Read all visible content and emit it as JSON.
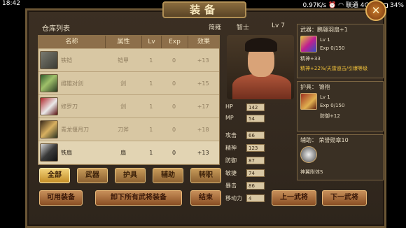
{
  "status_bar": {
    "time": "18:42",
    "net": "0.97K/s",
    "network_label": "联通 4G",
    "battery": "34%",
    "battery_level": 0.34
  },
  "title": "装备",
  "close_label": "✕",
  "inventory": {
    "title": "仓库列表",
    "columns": [
      "名称",
      "属性",
      "Lv",
      "Exp",
      "效果"
    ],
    "items": [
      {
        "name": "铁铠",
        "attr": "铠甲",
        "lv": "1",
        "exp": "0",
        "effect": "+13",
        "icon": "armor-icon",
        "selected": false
      },
      {
        "name": "雌雄对剑",
        "attr": "剑",
        "lv": "1",
        "exp": "0",
        "effect": "+15",
        "icon": "twin-sword-icon",
        "selected": false
      },
      {
        "name": "修罗刀",
        "attr": "剑",
        "lv": "1",
        "exp": "0",
        "effect": "+17",
        "icon": "blade-icon",
        "selected": false
      },
      {
        "name": "青龙偃月刀",
        "attr": "刀斧",
        "lv": "1",
        "exp": "0",
        "effect": "+18",
        "icon": "glaive-icon",
        "selected": false
      },
      {
        "name": "铁扇",
        "attr": "扇",
        "lv": "1",
        "exp": "0",
        "effect": "+13",
        "icon": "fan-icon",
        "selected": true
      }
    ]
  },
  "tabs": [
    {
      "label": "全部",
      "active": true
    },
    {
      "label": "武器",
      "active": false
    },
    {
      "label": "护具",
      "active": false
    },
    {
      "label": "辅助",
      "active": false
    },
    {
      "label": "转职",
      "active": false
    }
  ],
  "bottom_buttons": {
    "usable": "可用装备",
    "unequip_all": "卸下所有武将装备",
    "finish": "结束",
    "prev": "上一武将",
    "next": "下一武将"
  },
  "hero": {
    "name": "简雍",
    "class": "智士",
    "level": "Lv 7",
    "stats": [
      {
        "label": "HP",
        "value": "142"
      },
      {
        "label": "MP",
        "value": "54"
      },
      {
        "label": "攻击",
        "value": "66"
      },
      {
        "label": "精神",
        "value": "123"
      },
      {
        "label": "防御",
        "value": "87"
      },
      {
        "label": "敏捷",
        "value": "74"
      },
      {
        "label": "暴击",
        "value": "86"
      },
      {
        "label": "移动力",
        "value": "4"
      }
    ]
  },
  "equipment": {
    "weapon": {
      "header": "武器：鹏翮羽扇+1",
      "lv": "Lv    1",
      "exp": "Exp  0/150",
      "bonus": "精神+33",
      "special": "精神+22%/天雷道击/引爆等级"
    },
    "armor": {
      "header": "护具：  锦袍",
      "lv": "Lv    1",
      "exp": "Exp  0/150",
      "bonus": "防御+12"
    },
    "accessory": {
      "header": "辅助：  荣誉勋章10",
      "effect": "神翼附体S"
    }
  }
}
